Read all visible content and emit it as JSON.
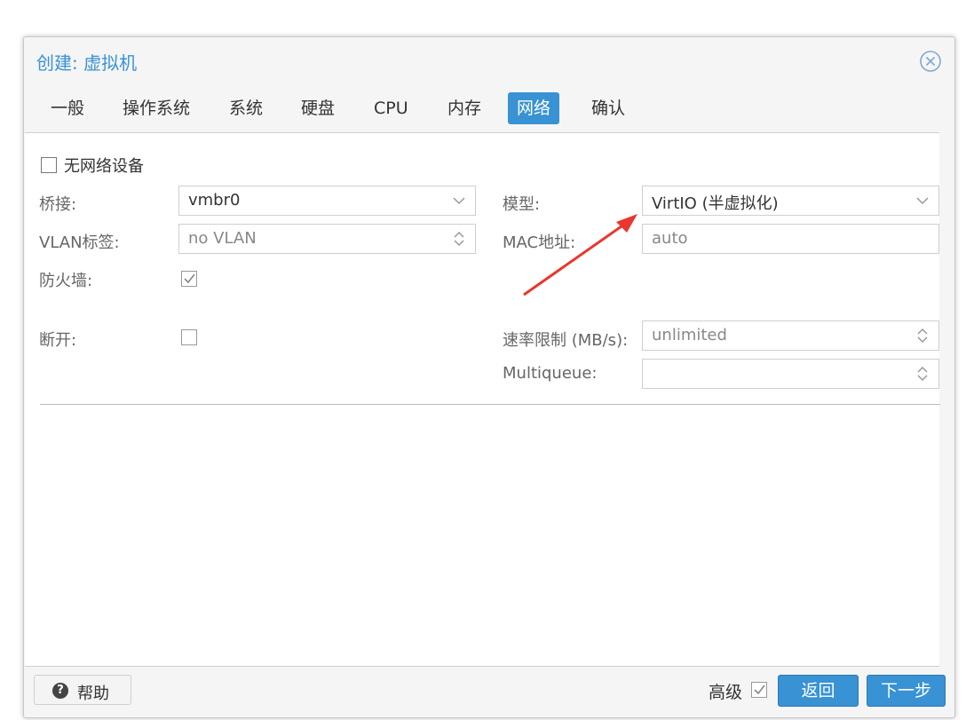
{
  "window": {
    "title": "创建: 虚拟机"
  },
  "tabs": [
    {
      "label": "一般"
    },
    {
      "label": "操作系统"
    },
    {
      "label": "系统"
    },
    {
      "label": "硬盘"
    },
    {
      "label": "CPU"
    },
    {
      "label": "内存"
    },
    {
      "label": "网络",
      "active": true
    },
    {
      "label": "确认"
    }
  ],
  "form": {
    "no_network_label": "无网络设备",
    "no_network_checked": false,
    "bridge_label": "桥接:",
    "bridge_value": "vmbr0",
    "vlan_label": "VLAN标签:",
    "vlan_value": "no VLAN",
    "firewall_label": "防火墙:",
    "firewall_checked": true,
    "model_label": "模型:",
    "model_value": "VirtIO (半虚拟化)",
    "mac_label": "MAC地址:",
    "mac_value": "auto",
    "disconnect_label": "断开:",
    "disconnect_checked": false,
    "rate_label": "速率限制 (MB/s):",
    "rate_value": "unlimited",
    "multiqueue_label": "Multiqueue:",
    "multiqueue_value": ""
  },
  "footer": {
    "help_label": "帮助",
    "advanced_label": "高级",
    "advanced_checked": true,
    "back_label": "返回",
    "next_label": "下一步"
  },
  "colors": {
    "accent": "#3892d4",
    "annotation_arrow": "#e8372f"
  },
  "icons": {
    "close": "circle-x-icon",
    "help": "question-circle-icon",
    "dropdown": "chevron-down-icon",
    "spinner": "spinner-updown-icon"
  }
}
